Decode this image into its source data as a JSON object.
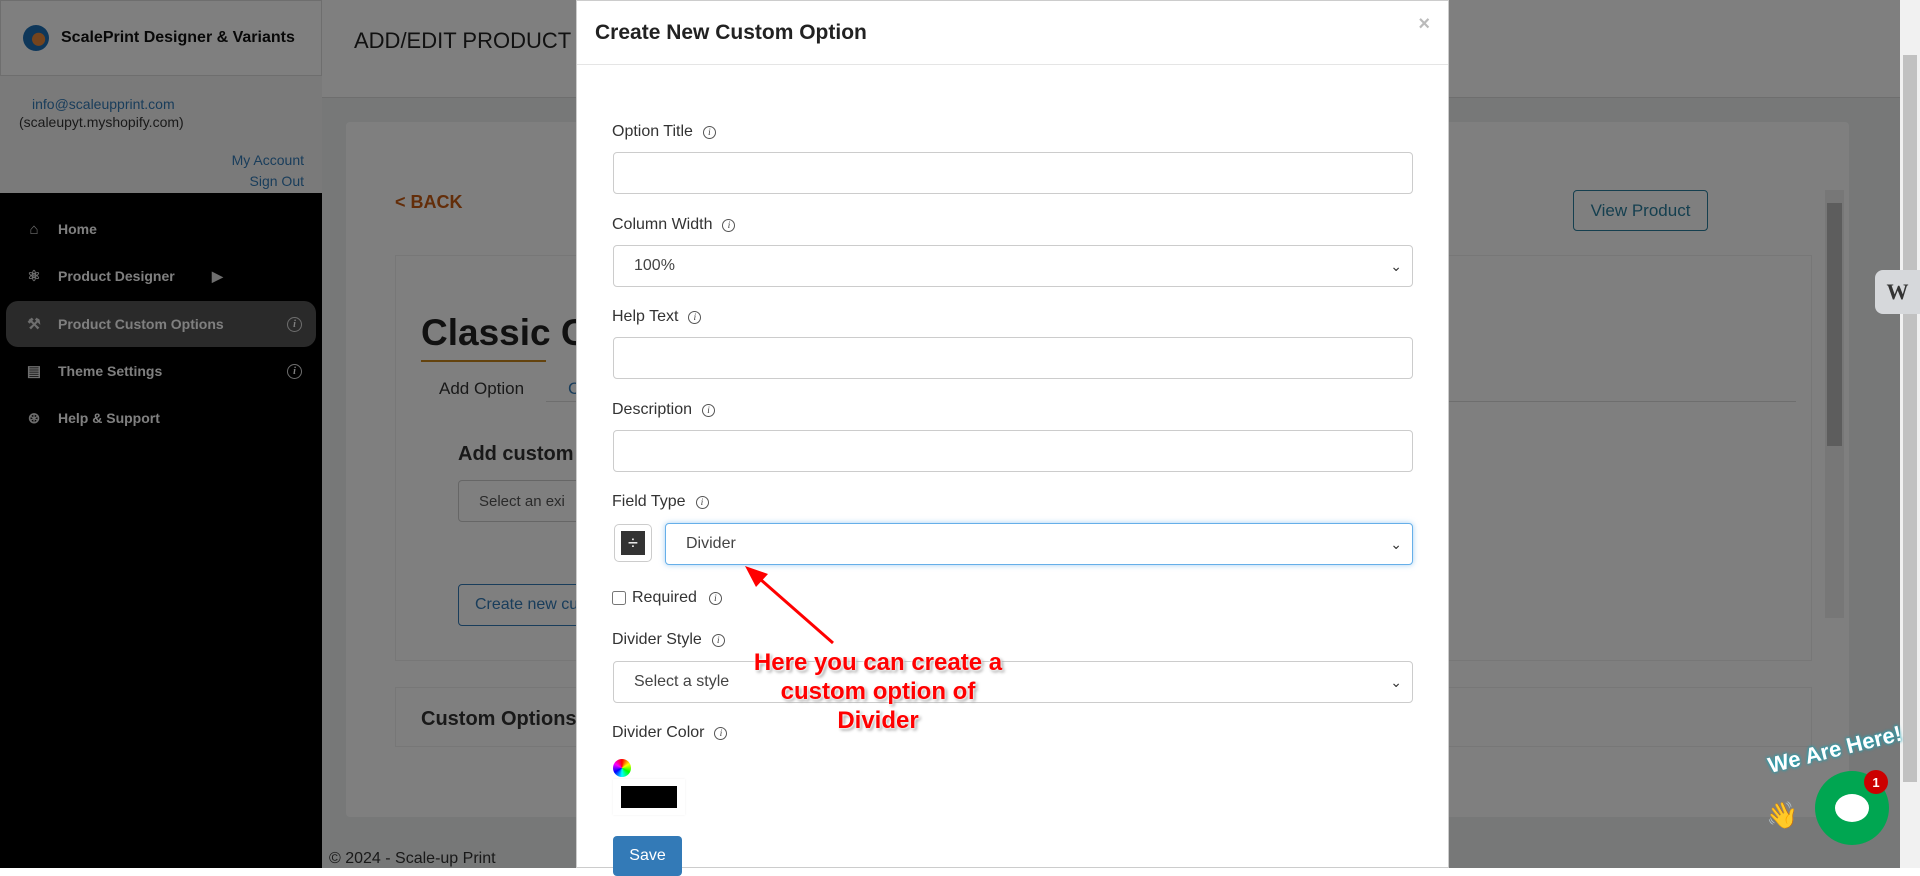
{
  "sidebar": {
    "app_name": "ScalePrint Designer & Variants",
    "email": "info@scaleupprint.com",
    "shop": "(scaleupyt.myshopify.com)",
    "my_account": "My Account",
    "sign_out": "Sign Out",
    "items": [
      {
        "label": "Home",
        "icon": "home-icon"
      },
      {
        "label": "Product Designer",
        "icon": "network-icon"
      },
      {
        "label": "Product Custom Options",
        "icon": "tools-icon"
      },
      {
        "label": "Theme Settings",
        "icon": "theme-icon"
      },
      {
        "label": "Help & Support",
        "icon": "lifebuoy-icon"
      }
    ]
  },
  "page": {
    "title": "ADD/EDIT PRODUCT C",
    "back": "< BACK",
    "view_product": "View Product",
    "product_title": "Classic C",
    "tabs": [
      "Add Option",
      "C"
    ],
    "add_custom": "Add custom",
    "select_existing": "Select an exi",
    "create_new": "Create new cu",
    "custom_options": "Custom Options",
    "footer": "© 2024 - Scale-up Print"
  },
  "modal": {
    "title": "Create New Custom Option",
    "close": "×",
    "option_title": {
      "label": "Option Title",
      "value": ""
    },
    "column_width": {
      "label": "Column Width",
      "value": "100%"
    },
    "help_text": {
      "label": "Help Text",
      "value": ""
    },
    "description": {
      "label": "Description",
      "value": ""
    },
    "field_type": {
      "label": "Field Type",
      "value": "Divider"
    },
    "required": {
      "label": "Required",
      "checked": false
    },
    "divider_style": {
      "label": "Divider Style",
      "value": "Select a style"
    },
    "divider_color": {
      "label": "Divider Color",
      "value": "#000000"
    },
    "save": "Save"
  },
  "annotation": {
    "lines": [
      "Here you can create a",
      "custom option of",
      "Divider"
    ],
    "color": "#ff0000"
  },
  "chat": {
    "badge": "1",
    "caption": "We Are Here!",
    "color": "#00a651"
  },
  "colors": {
    "accent_orange": "#c75b12",
    "link_blue": "#337ab7",
    "save_blue": "#337ab7"
  }
}
